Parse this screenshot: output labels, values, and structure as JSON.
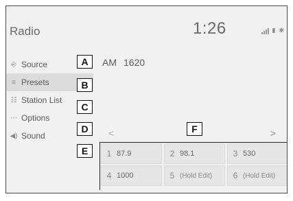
{
  "header": {
    "title": "Radio",
    "clock": "1:26"
  },
  "status_icons": [
    "signal-icon",
    "phone-battery-icon",
    "bluetooth-icon"
  ],
  "sidebar": {
    "items": [
      {
        "label": "Source",
        "icon": "source-icon",
        "selected": false
      },
      {
        "label": "Presets",
        "icon": "presets-icon",
        "selected": true
      },
      {
        "label": "Station List",
        "icon": "station-list-icon",
        "selected": false
      },
      {
        "label": "Options",
        "icon": "options-icon",
        "selected": false
      },
      {
        "label": "Sound",
        "icon": "speaker-icon",
        "selected": false
      }
    ]
  },
  "station": {
    "band": "AM",
    "frequency": "1620"
  },
  "pager": {
    "prev": "<",
    "next": ">"
  },
  "presets": [
    {
      "num": "1",
      "value": "87.9"
    },
    {
      "num": "2",
      "value": "98.1"
    },
    {
      "num": "3",
      "value": "530"
    },
    {
      "num": "4",
      "value": "1000"
    },
    {
      "num": "5",
      "value": "(Hold Edit)"
    },
    {
      "num": "6",
      "value": "(Hold Edit)"
    }
  ],
  "callouts": {
    "a": "A",
    "b": "B",
    "c": "C",
    "d": "D",
    "e": "E",
    "f": "F"
  }
}
